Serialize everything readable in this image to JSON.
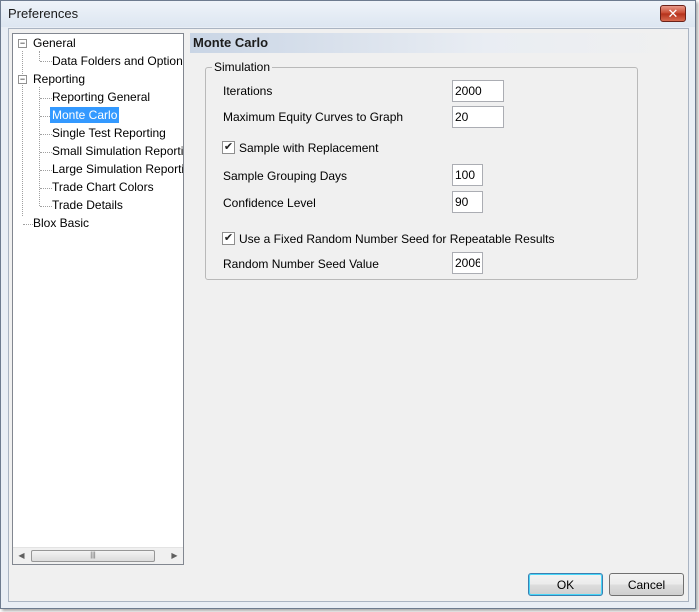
{
  "window": {
    "title": "Preferences",
    "close_glyph": "✕"
  },
  "tree": {
    "items": [
      {
        "label": "General",
        "expander": "−"
      },
      {
        "label": "Data Folders and Options"
      },
      {
        "label": "Reporting",
        "expander": "−"
      },
      {
        "label": "Reporting General"
      },
      {
        "label": "Monte Carlo",
        "selected": true
      },
      {
        "label": "Single Test Reporting"
      },
      {
        "label": "Small Simulation Reporting"
      },
      {
        "label": "Large Simulation Reporting"
      },
      {
        "label": "Trade Chart Colors"
      },
      {
        "label": "Trade Details"
      },
      {
        "label": "Blox Basic"
      }
    ],
    "scroll_left": "◀",
    "scroll_right": "▶",
    "scroll_grip": "|||"
  },
  "panel": {
    "title": "Monte Carlo",
    "group": "Simulation",
    "iterations_label": "Iterations",
    "iterations_value": "2000",
    "max_curves_label": "Maximum Equity Curves to Graph",
    "max_curves_value": "20",
    "sample_replacement_label": "Sample with Replacement",
    "sample_replacement_checked": "✔",
    "grouping_days_label": "Sample Grouping Days",
    "grouping_days_value": "100",
    "confidence_label": "Confidence Level",
    "confidence_value": "90",
    "fixed_seed_label": "Use a Fixed Random Number Seed for Repeatable Results",
    "fixed_seed_checked": "✔",
    "seed_label": "Random Number Seed Value",
    "seed_value": "2006"
  },
  "buttons": {
    "ok": "OK",
    "cancel": "Cancel"
  }
}
